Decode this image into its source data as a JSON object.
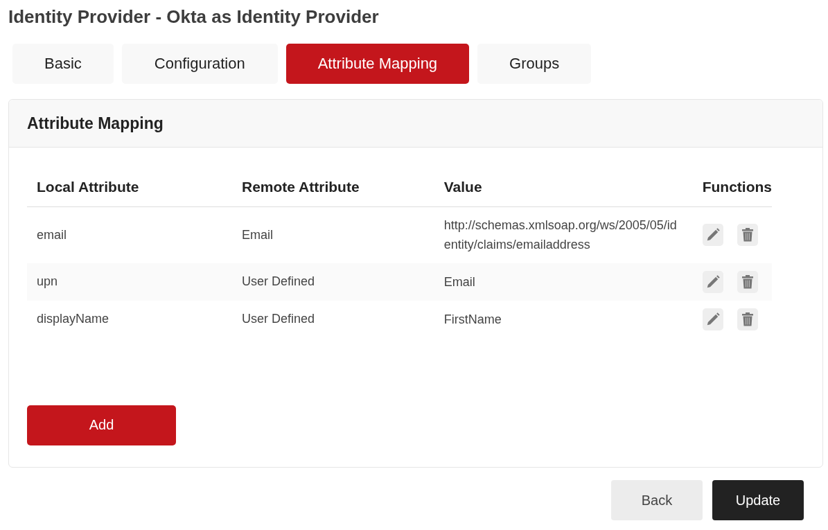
{
  "page_title": "Identity Provider - Okta as Identity Provider",
  "tabs": [
    {
      "label": "Basic",
      "selected": false
    },
    {
      "label": "Configuration",
      "selected": false
    },
    {
      "label": "Attribute Mapping",
      "selected": true
    },
    {
      "label": "Groups",
      "selected": false
    }
  ],
  "panel": {
    "title": "Attribute Mapping",
    "table": {
      "columns": [
        "Local Attribute",
        "Remote Attribute",
        "Value",
        "Functions"
      ],
      "rows": [
        {
          "local": "email",
          "remote": "Email",
          "value": "http://schemas.xmlsoap.org/ws/2005/05/identity/claims/emailaddress"
        },
        {
          "local": "upn",
          "remote": "User Defined",
          "value": "Email"
        },
        {
          "local": "displayName",
          "remote": "User Defined",
          "value": "FirstName"
        }
      ]
    },
    "add_button": "Add"
  },
  "footer_buttons": [
    {
      "label": "Back",
      "kind": "secondary"
    },
    {
      "label": "Update",
      "kind": "primary"
    }
  ]
}
